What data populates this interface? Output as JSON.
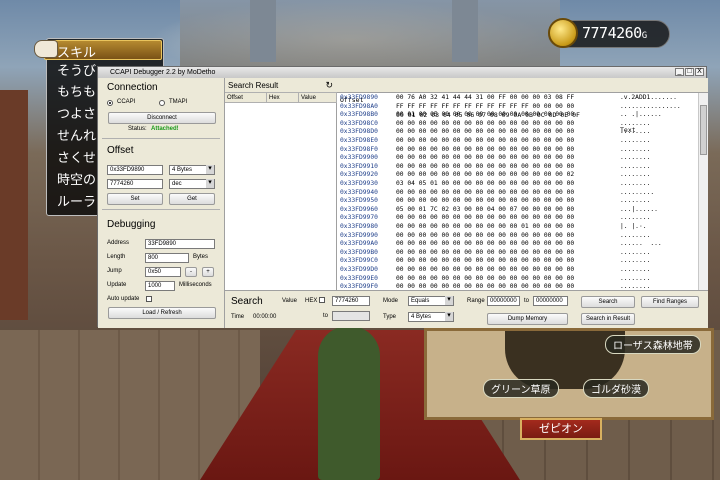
{
  "game": {
    "gold": "7774260",
    "gold_unit": "G",
    "menu_items": [
      "スキル",
      "そうび",
      "もちもの",
      "つよさ",
      "せんれき",
      "さくせん",
      "時空の",
      "ルーラ"
    ],
    "map_labels": {
      "north": "ローザス森林地帯",
      "west": "グリーン草原",
      "east": "ゴルダ砂漠",
      "banner": "ゼピオン"
    }
  },
  "debugger": {
    "title": "CCAPI Debugger 2.2 by MoDetho",
    "window_buttons": [
      "_",
      "□",
      "X"
    ],
    "connection": {
      "heading": "Connection",
      "radio_ccapi": "CCAPI",
      "radio_tmapi": "TMAPI",
      "disconnect_label": "Disconnect",
      "status_label": "Status:",
      "status_value": "Attached!",
      "status_color": "#1a9a1a"
    },
    "offset": {
      "heading": "Offset",
      "address": "0x33FD9890",
      "size": "4 Bytes",
      "value": "7774260",
      "format": "dec",
      "set_label": "Set",
      "get_label": "Get"
    },
    "debugging": {
      "heading": "Debugging",
      "address_label": "Address",
      "address_value": "33FD9890",
      "length_label": "Length",
      "length_value": "800",
      "length_unit": "Bytes",
      "jump_label": "Jump",
      "jump_value": "0x50",
      "jump_minus": "-",
      "jump_plus": "+",
      "update_label": "Update",
      "update_value": "1000",
      "update_unit": "Milliseconds",
      "auto_update_label": "Auto update",
      "load_refresh_label": "Load / Refresh"
    },
    "search_result": {
      "heading": "Search Result",
      "refresh_icon": "↻",
      "columns": [
        "Offset",
        "Hex",
        "Value"
      ]
    },
    "hex_view": {
      "header_offset": "Offset",
      "header_bytes": "00 01 02 03 04 05 06 07 08 09 0A 0B 0C 0D 0E 0F",
      "header_text": "Text",
      "rows": [
        {
          "offset": "0x33FD9890",
          "hex": "00 76 A0 32 41 44 44 31 00 FF 00 00 00 03 08 FF",
          "text": ".v.2ADD1......."
        },
        {
          "offset": "0x33FD98A0",
          "hex": "FF FF FF FF FF FF FF FF FF FF FF FF 00 00 00 00",
          "text": "................"
        },
        {
          "offset": "0x33FD98B0",
          "hex": "00 01 00 05 00 00 00 00 00 00 00 00 00 00 00 00",
          "text": ".. .|......"
        },
        {
          "offset": "0x33FD98C0",
          "hex": "00 00 00 00 00 00 00 00 00 00 00 00 00 00 00 00",
          "text": "........"
        },
        {
          "offset": "0x33FD98D0",
          "hex": "00 00 00 00 00 00 00 00 00 00 00 00 00 00 00 00",
          "text": "........"
        },
        {
          "offset": "0x33FD98E0",
          "hex": "00 00 00 00 00 00 00 00 00 00 00 00 00 00 00 00",
          "text": "........"
        },
        {
          "offset": "0x33FD98F0",
          "hex": "00 00 00 00 00 00 00 00 00 00 00 00 00 00 00 00",
          "text": "........"
        },
        {
          "offset": "0x33FD9900",
          "hex": "00 00 00 00 00 00 00 00 00 00 00 00 00 00 00 00",
          "text": "........"
        },
        {
          "offset": "0x33FD9910",
          "hex": "00 00 00 00 00 00 00 00 00 00 00 00 00 00 00 00",
          "text": "........"
        },
        {
          "offset": "0x33FD9920",
          "hex": "00 00 00 00 00 00 00 00 00 00 00 00 00 00 00 02",
          "text": "........"
        },
        {
          "offset": "0x33FD9930",
          "hex": "03 04 05 01 00 00 00 00 00 00 00 00 00 00 00 00",
          "text": "........"
        },
        {
          "offset": "0x33FD9940",
          "hex": "00 00 00 00 00 00 00 00 00 00 00 00 00 00 00 00",
          "text": "........."
        },
        {
          "offset": "0x33FD9950",
          "hex": "00 00 00 00 00 00 00 00 00 00 00 00 00 00 00 00",
          "text": "........"
        },
        {
          "offset": "0x33FD9960",
          "hex": "05 00 01 7C 02 03 00 00 04 00 07 00 00 00 00 00",
          "text": "...|......"
        },
        {
          "offset": "0x33FD9970",
          "hex": "00 00 00 00 00 00 00 00 00 00 00 00 00 00 00 00",
          "text": "........"
        },
        {
          "offset": "0x33FD9980",
          "hex": "00 00 00 00 00 00 00 00 00 00 00 01 00 00 00 00",
          "text": "|. |.·."
        },
        {
          "offset": "0x33FD9990",
          "hex": "00 00 00 00 00 00 00 00 00 00 00 00 00 00 00 00",
          "text": "........"
        },
        {
          "offset": "0x33FD99A0",
          "hex": "00 00 00 00 00 00 00 00 00 00 00 00 00 00 00 00",
          "text": "......  ..."
        },
        {
          "offset": "0x33FD99B0",
          "hex": "00 00 00 00 00 00 00 00 00 00 00 00 00 00 00 00",
          "text": "........"
        },
        {
          "offset": "0x33FD99C0",
          "hex": "00 00 00 00 00 00 00 00 00 00 00 00 00 00 00 00",
          "text": "........"
        },
        {
          "offset": "0x33FD99D0",
          "hex": "00 00 00 00 00 00 00 00 00 00 00 00 00 00 00 00",
          "text": "........"
        },
        {
          "offset": "0x33FD99E0",
          "hex": "00 00 00 00 00 00 00 00 00 00 00 00 00 00 00 00",
          "text": "........"
        },
        {
          "offset": "0x33FD99F0",
          "hex": "00 00 00 00 00 00 00 00 00 00 00 00 00 00 00 00",
          "text": "........"
        }
      ]
    },
    "search": {
      "heading": "Search",
      "value_label": "Value",
      "hex_label": "HEX",
      "value_input": "7774260",
      "to_label": "to",
      "mode_label": "Mode",
      "mode_value": "Equals",
      "type_label": "Type",
      "type_value": "4 Bytes",
      "range_label": "Range",
      "range_from": "00000000",
      "range_to_label": "to",
      "range_to": "00000000",
      "search_button": "Search",
      "find_ranges_button": "Find Ranges",
      "dump_memory_button": "Dump Memory",
      "search_in_result_button": "Search in Result",
      "time_label": "Time",
      "time_value": "00:00:00"
    }
  }
}
